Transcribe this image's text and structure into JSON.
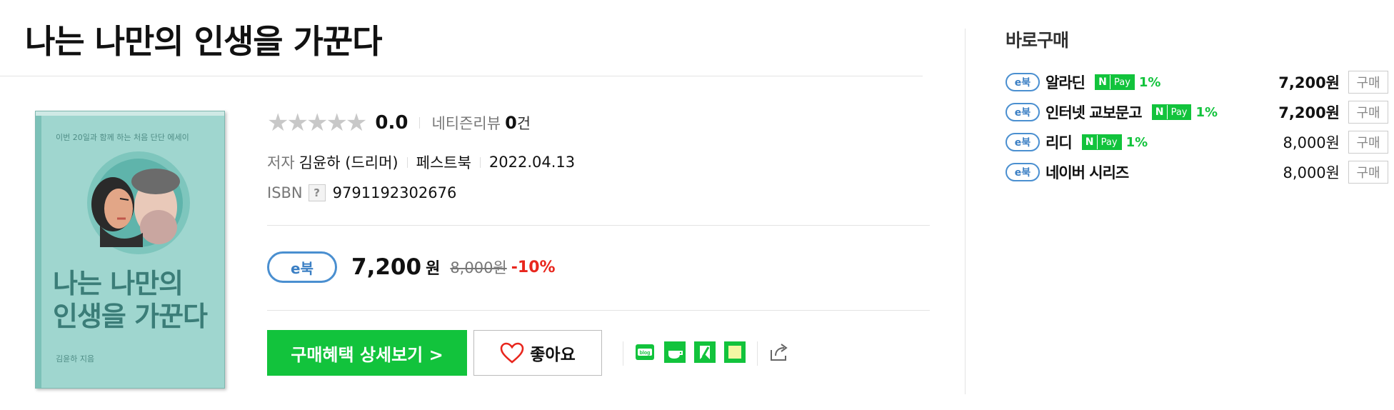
{
  "book": {
    "title": "나는 나만의 인생을 가꾼다",
    "cover": {
      "tagline": "이번 20일과 함께 하는 처음 단단 에세이",
      "title_line1": "나는 나만의",
      "title_line2": "인생을 가꾼다",
      "author": "김윤하 지음",
      "bg_color": "#9fd6cf"
    }
  },
  "rating": {
    "stars": "★★★★★",
    "score": "0.0",
    "review_label": "네티즌리뷰",
    "review_count": "0",
    "review_unit": "건"
  },
  "meta": {
    "author_label": "저자",
    "author": "김윤하 (드리머)",
    "publisher": "페스트북",
    "date": "2022.04.13",
    "isbn_label": "ISBN",
    "isbn_help": "?",
    "isbn": "9791192302676"
  },
  "price": {
    "badge": "e북",
    "value": "7,200",
    "currency": "원",
    "original": "8,000원",
    "discount": "-10%"
  },
  "actions": {
    "buy_benefit_label": "구매혜택 상세보기 >",
    "like_label": "좋아요",
    "share_icons": [
      "blog-icon",
      "cafe-icon",
      "bookmark-icon",
      "memo-icon",
      "share-icon"
    ]
  },
  "direct_buy": {
    "title": "바로구매",
    "badge": "e북",
    "npay_n": "N",
    "npay_pay": "Pay",
    "buy_label": "구매",
    "stores": [
      {
        "name": "알라딘",
        "npay": true,
        "npay_pct": "1%",
        "price": "7,200원",
        "bold": true
      },
      {
        "name": "인터넷 교보문고",
        "npay": true,
        "npay_pct": "1%",
        "price": "7,200원",
        "bold": true
      },
      {
        "name": "리디",
        "npay": true,
        "npay_pct": "1%",
        "price": "8,000원",
        "bold": false
      },
      {
        "name": "네이버 시리즈",
        "npay": false,
        "npay_pct": "",
        "price": "8,000원",
        "bold": false
      }
    ]
  },
  "colors": {
    "accent_green": "#12c33c",
    "ebook_blue": "#4a8fd0",
    "discount_red": "#e8261d"
  }
}
